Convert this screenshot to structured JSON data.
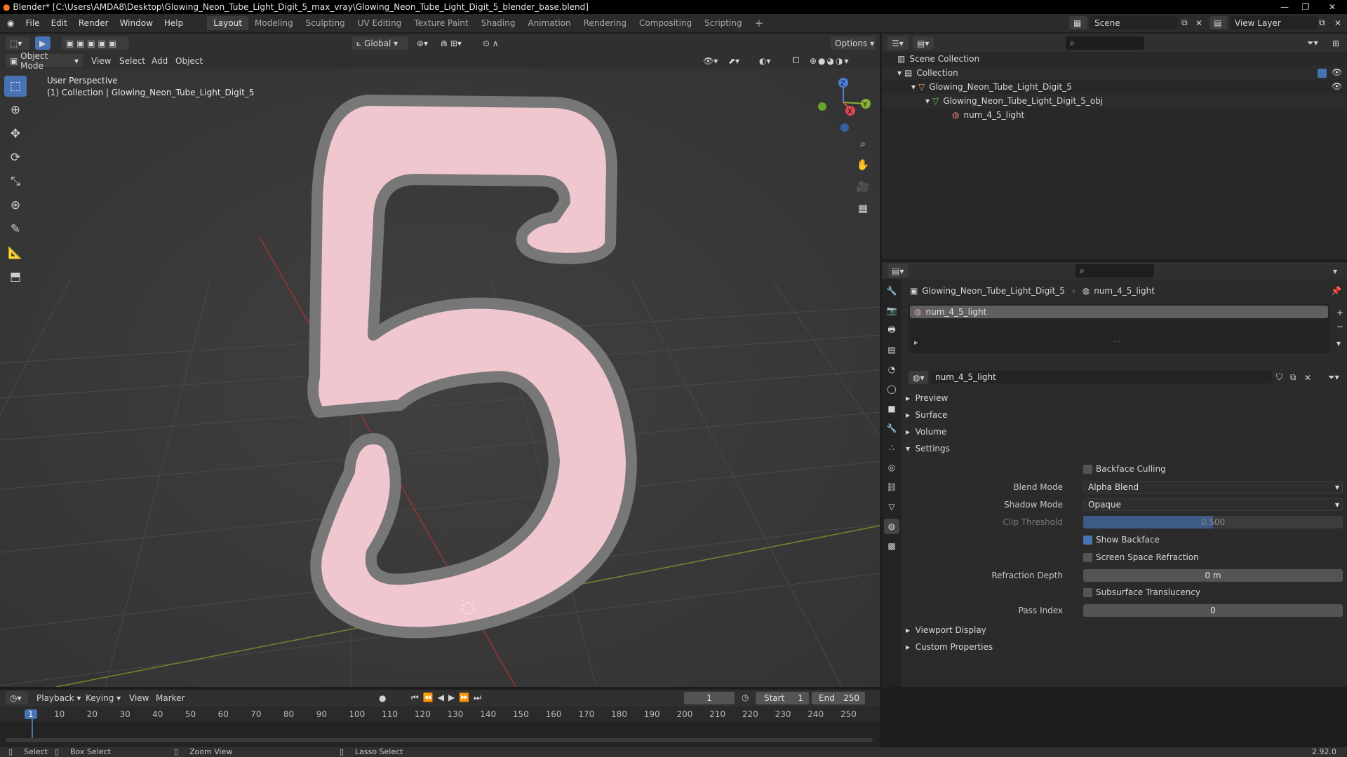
{
  "window": {
    "title": "Blender* [C:\\Users\\AMDA8\\Desktop\\Glowing_Neon_Tube_Light_Digit_5_max_vray\\Glowing_Neon_Tube_Light_Digit_5_blender_base.blend]"
  },
  "menus": [
    "File",
    "Edit",
    "Render",
    "Window",
    "Help"
  ],
  "workspaces": [
    {
      "label": "Layout",
      "active": true
    },
    {
      "label": "Modeling",
      "active": false
    },
    {
      "label": "Sculpting",
      "active": false
    },
    {
      "label": "UV Editing",
      "active": false
    },
    {
      "label": "Texture Paint",
      "active": false
    },
    {
      "label": "Shading",
      "active": false
    },
    {
      "label": "Animation",
      "active": false
    },
    {
      "label": "Rendering",
      "active": false
    },
    {
      "label": "Compositing",
      "active": false
    },
    {
      "label": "Scripting",
      "active": false
    }
  ],
  "scene": {
    "name": "Scene"
  },
  "view_layer": {
    "name": "View Layer"
  },
  "viewport": {
    "transform_orientation": "Global",
    "options_label": "Options",
    "mode": "Object Mode",
    "header_menus": [
      "View",
      "Select",
      "Add",
      "Object"
    ],
    "overlay_title": "User Perspective",
    "overlay_collection": "(1) Collection | Glowing_Neon_Tube_Light_Digit_5",
    "gizmo_axes": {
      "x": "X",
      "y": "Y",
      "z": "Z"
    }
  },
  "outliner": {
    "root": "Scene Collection",
    "collection": "Collection",
    "object": "Glowing_Neon_Tube_Light_Digit_5",
    "mesh": "Glowing_Neon_Tube_Light_Digit_5_obj",
    "material": "num_4_5_light"
  },
  "properties": {
    "breadcrumb_object": "Glowing_Neon_Tube_Light_Digit_5",
    "breadcrumb_material": "num_4_5_light",
    "slot_name": "num_4_5_light",
    "material_name": "num_4_5_light",
    "panels": {
      "preview": "Preview",
      "surface": "Surface",
      "volume": "Volume",
      "settings": "Settings",
      "viewport_display": "Viewport Display",
      "custom_properties": "Custom Properties"
    },
    "settings": {
      "backface_culling": {
        "label": "Backface Culling",
        "checked": false
      },
      "blend_mode": {
        "label": "Blend Mode",
        "value": "Alpha Blend"
      },
      "shadow_mode": {
        "label": "Shadow Mode",
        "value": "Opaque"
      },
      "clip_threshold": {
        "label": "Clip Threshold",
        "value": "0.500",
        "fraction": 0.5
      },
      "show_backface": {
        "label": "Show Backface",
        "checked": true
      },
      "ssr": {
        "label": "Screen Space Refraction",
        "checked": false
      },
      "refraction_depth": {
        "label": "Refraction Depth",
        "value": "0 m"
      },
      "subsurface": {
        "label": "Subsurface Translucency",
        "checked": false
      },
      "pass_index": {
        "label": "Pass Index",
        "value": "0"
      }
    }
  },
  "timeline": {
    "menus": [
      "Playback",
      "Keying",
      "View",
      "Marker"
    ],
    "current_frame": "1",
    "start_label": "Start",
    "start": "1",
    "end_label": "End",
    "end": "250",
    "ticks": [
      "1",
      "10",
      "20",
      "30",
      "40",
      "50",
      "60",
      "70",
      "80",
      "90",
      "100",
      "110",
      "120",
      "130",
      "140",
      "150",
      "160",
      "170",
      "180",
      "190",
      "200",
      "210",
      "220",
      "230",
      "240",
      "250"
    ]
  },
  "statusbar": {
    "select": "Select",
    "box_select": "Box Select",
    "zoom_view": "Zoom View",
    "lasso_select": "Lasso Select",
    "version": "2.92.0"
  }
}
